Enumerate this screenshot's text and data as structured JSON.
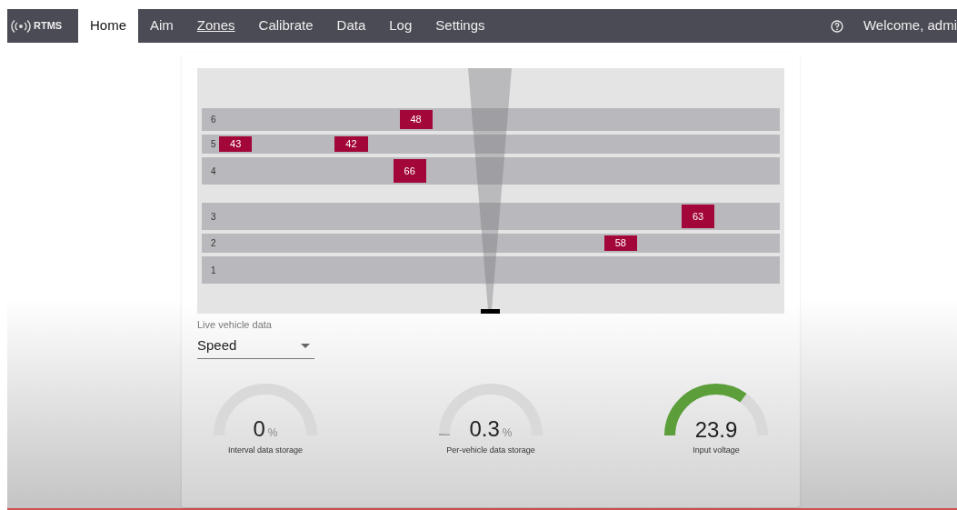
{
  "nav": {
    "brand": "RTMS",
    "tabs": [
      {
        "label": "Home",
        "selected": true,
        "hovered": false
      },
      {
        "label": "Aim",
        "selected": false,
        "hovered": false
      },
      {
        "label": "Zones",
        "selected": false,
        "hovered": true
      },
      {
        "label": "Calibrate",
        "selected": false,
        "hovered": false
      },
      {
        "label": "Data",
        "selected": false,
        "hovered": false
      },
      {
        "label": "Log",
        "selected": false,
        "hovered": false
      },
      {
        "label": "Settings",
        "selected": false,
        "hovered": false
      }
    ],
    "user": "Welcome, admi"
  },
  "zones": {
    "directions": [
      {
        "lanes": [
          {
            "label": "6",
            "vehicles": [
              {
                "speed": "48",
                "level": 0.342
              }
            ]
          },
          {
            "label": "5",
            "vehicles": [
              {
                "speed": "43",
                "level": 0.03
              },
              {
                "speed": "42",
                "level": 0.23
              }
            ]
          },
          {
            "label": "4",
            "vehicles": [
              {
                "speed": "66",
                "level": 0.331
              }
            ]
          }
        ]
      },
      {
        "lanes": [
          {
            "label": "3",
            "vehicles": [
              {
                "speed": "63",
                "level": 0.83
              }
            ]
          },
          {
            "label": "2",
            "vehicles": [
              {
                "speed": "58",
                "level": 0.696
              }
            ]
          },
          {
            "label": "1"
          }
        ]
      }
    ]
  },
  "live_data": {
    "label": "Live vehicle data",
    "value": "Speed"
  },
  "gauges": [
    {
      "value": "0",
      "unit": "%",
      "label": "Interval data storage"
    },
    {
      "value": "0.3",
      "unit": "%",
      "label": "Per-vehicle data storage"
    },
    {
      "value": "23.9",
      "label": "Input voltage"
    }
  ]
}
